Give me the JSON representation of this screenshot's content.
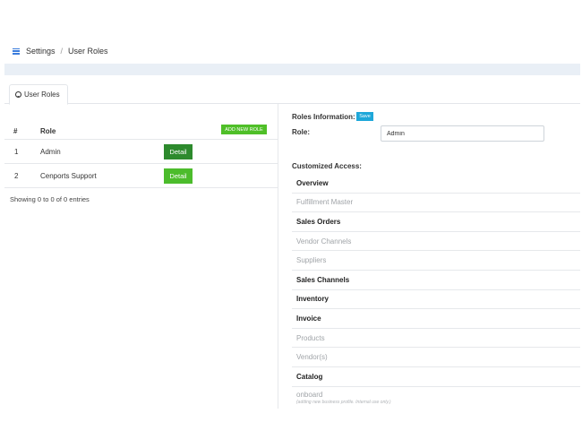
{
  "breadcrumb": {
    "settings": "Settings",
    "separator": "/",
    "current": "User Roles"
  },
  "tabs": [
    {
      "label": "User Roles"
    }
  ],
  "roles_table": {
    "headers": {
      "num": "#",
      "role": "Role"
    },
    "add_button": "ADD NEW ROLE",
    "rows": [
      {
        "num": "1",
        "name": "Admin",
        "action": "Detail"
      },
      {
        "num": "2",
        "name": "Cenports Support",
        "action": "Detail"
      }
    ],
    "entries_text": "Showing 0 to 0 of 0 entries"
  },
  "roles_info": {
    "title": "Roles Information:",
    "save_label": "Save",
    "role_label": "Role:",
    "role_value": "Admin",
    "customized_access_label": "Customized Access:"
  },
  "access_items": [
    {
      "label": "Overview",
      "type": "section"
    },
    {
      "label": "Fulfillment Master",
      "type": "item"
    },
    {
      "label": "Sales Orders",
      "type": "section"
    },
    {
      "label": "Vendor Channels",
      "type": "item"
    },
    {
      "label": "Suppliers",
      "type": "item"
    },
    {
      "label": "Sales Channels",
      "type": "section"
    },
    {
      "label": "Inventory",
      "type": "section"
    },
    {
      "label": "Invoice",
      "type": "section"
    },
    {
      "label": "Products",
      "type": "item"
    },
    {
      "label": "Vendor(s)",
      "type": "item"
    },
    {
      "label": "Catalog",
      "type": "section"
    },
    {
      "label": "onboard",
      "type": "item",
      "sublabel": "(adding new business profile. Internal use only.)"
    }
  ],
  "colors": {
    "add_button": "#4fbf28",
    "detail_admin": "#2d8a2d",
    "detail_support": "#4cbc2c",
    "save_button": "#1ea7d9",
    "header_strip": "#e9eff6",
    "menu_icon": "#3b7ddd"
  },
  "icons": {
    "menu": "hamburger-menu-icon",
    "tab": "user-circle-icon"
  }
}
